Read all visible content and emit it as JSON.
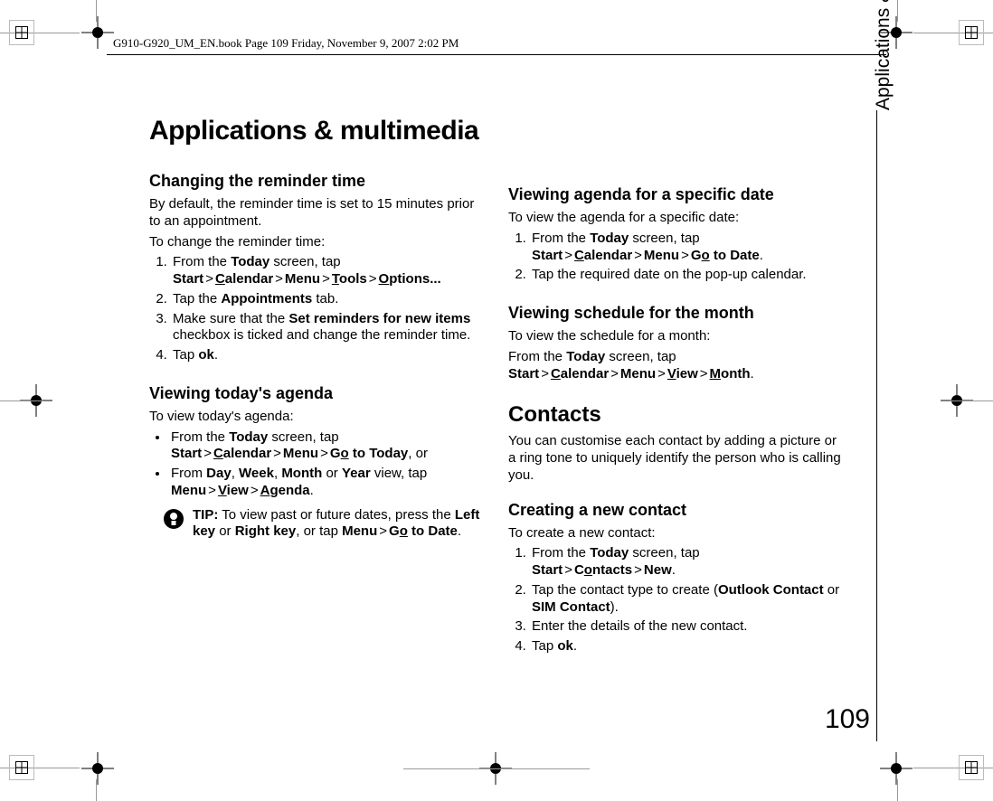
{
  "header": "G910-G920_UM_EN.book  Page 109  Friday, November 9, 2007  2:02 PM",
  "title": "Applications & multimedia",
  "sideLabel": "Applications & multimedia",
  "pageNumber": "109",
  "left": {
    "s1": {
      "heading": "Changing the reminder time",
      "p1": "By default, the reminder time is set to 15 minutes prior to an appointment.",
      "p2": "To change the reminder time:",
      "steps": {
        "i1": {
          "pre": "From the ",
          "today": "Today",
          "mid1": " screen, tap ",
          "start": "Start",
          "calUL": "C",
          "cal": "alendar",
          "menu": "Menu",
          "toolsUL": "T",
          "tools": "ools",
          "optUL": "O",
          "opt": "ptions..."
        },
        "i2": {
          "pre": "Tap the ",
          "b": "Appointments",
          "post": " tab."
        },
        "i3": {
          "pre": "Make sure that the ",
          "b": "Set reminders for new items",
          "post": " checkbox is ticked and change the reminder time."
        },
        "i4": {
          "pre": "Tap ",
          "b": "ok",
          "post": "."
        }
      }
    },
    "s2": {
      "heading": "Viewing today's agenda",
      "p1": "To view today's agenda:",
      "b1": {
        "pre": "From the ",
        "today": "Today",
        "mid": " screen, tap ",
        "start": "Start",
        "calUL": "C",
        "cal": "alendar",
        "menu": "Menu",
        "goUL1": "G",
        "go1": "o",
        "go2": " to Today",
        "post": ", or"
      },
      "b2": {
        "pre": "From ",
        "d": "Day",
        "c1": ", ",
        "w": "Week",
        "c2": ", ",
        "m": "Month",
        "c3": " or ",
        "y": "Year",
        "mid": " view, tap ",
        "menu": "Menu",
        "vUL": "V",
        "view": "iew",
        "aUL": "A",
        "agenda": "genda",
        "post": "."
      },
      "tip": {
        "label": "TIP:",
        "pre": " To view past or future dates, press the ",
        "lk": "Left key",
        "or": " or ",
        "rk": "Right key",
        "mid": ", or tap ",
        "menu": "Menu",
        "goUL1": "G",
        "go1": "o",
        "go2": " to Date",
        "post": "."
      }
    }
  },
  "right": {
    "s1": {
      "heading": "Viewing agenda for a specific date",
      "p1": "To view the agenda for a specific date:",
      "steps": {
        "i1": {
          "pre": "From the ",
          "today": "Today",
          "mid": " screen, tap ",
          "start": "Start",
          "calUL": "C",
          "cal": "alendar",
          "menu": "Menu",
          "goUL1": "G",
          "go1": "o",
          "go2": " to Date",
          "post": "."
        },
        "i2": {
          "t": "Tap the required date on the pop-up calendar."
        }
      }
    },
    "s2": {
      "heading": "Viewing schedule for the month",
      "p1": "To view the schedule for a month:",
      "p2": {
        "pre": "From the ",
        "today": "Today",
        "mid": " screen, tap ",
        "start": "Start",
        "calUL": "C",
        "cal": "alendar",
        "menu": "Menu",
        "vUL": "V",
        "view": "iew",
        "mUL": "M",
        "month": "onth",
        "post": "."
      }
    },
    "s3": {
      "heading": "Contacts",
      "p1": "You can customise each contact by adding a picture or a ring tone to uniquely identify the person who is calling you."
    },
    "s4": {
      "heading": "Creating a new contact",
      "p1": "To create a new contact:",
      "steps": {
        "i1": {
          "pre": "From the ",
          "today": "Today",
          "mid": " screen, tap ",
          "start": "Start",
          "coUL": "o",
          "co1": "C",
          "co2": "ntacts",
          "new": "New",
          "post": "."
        },
        "i2": {
          "pre": "Tap the contact type to create (",
          "o": "Outlook Contact",
          "or": " or ",
          "s": "SIM Contact",
          "post": ")."
        },
        "i3": {
          "t": "Enter the details of the new contact."
        },
        "i4": {
          "pre": "Tap ",
          "b": "ok",
          "post": "."
        }
      }
    }
  }
}
